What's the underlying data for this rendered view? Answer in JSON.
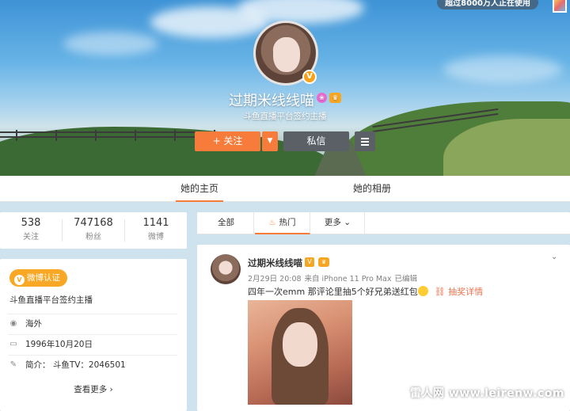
{
  "banner": {
    "recommend_text": "超过8000万人正在使用"
  },
  "profile": {
    "name": "过期米线线喵",
    "description": "斗鱼直播平台签约主播",
    "verify_badge": "V",
    "follow_label": "+ 关注",
    "message_label": "私信"
  },
  "tabs": {
    "home": "她的主页",
    "album": "她的相册"
  },
  "stats": [
    {
      "value": "538",
      "label": "关注"
    },
    {
      "value": "747168",
      "label": "粉丝"
    },
    {
      "value": "1141",
      "label": "微博"
    }
  ],
  "info": {
    "cert_badge": "微博认证",
    "cert_text": "斗鱼直播平台签约主播",
    "location": "海外",
    "birthday": "1996年10月20日",
    "bio": "简介： 斗鱼TV：2046501",
    "see_more": "查看更多 ›"
  },
  "feed_tabs": {
    "all": "全部",
    "hot": "热门",
    "more": "更多"
  },
  "post": {
    "author": "过期米线线喵",
    "date": "2月29日 20:08",
    "source": "来自 iPhone 11 Pro Max",
    "edited": "已编辑",
    "text": "四年一次emm   那评论里抽5个好兄弟送红包",
    "lottery": "抽奖详情"
  },
  "watermark": "雷人网 www.leirenw.com",
  "colors": {
    "accent": "#f77c3b",
    "cert": "#f9a825",
    "page_bg": "#cfe3ef"
  }
}
